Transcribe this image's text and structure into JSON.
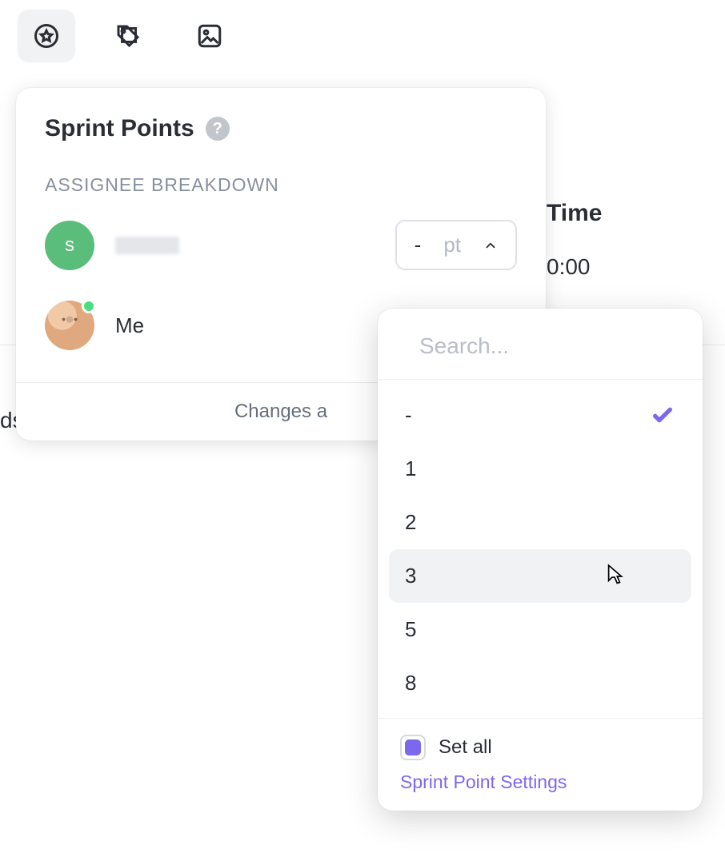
{
  "background": {
    "time_label": "Time",
    "time_value": "0:00",
    "left_fragment": "ds"
  },
  "card": {
    "title": "Sprint Points",
    "help_glyph": "?",
    "subheading": "ASSIGNEE BREAKDOWN",
    "assignees": [
      {
        "avatar_initial": "s",
        "name": "",
        "blurred": true
      },
      {
        "avatar_initial": "",
        "name": "Me",
        "blurred": false,
        "presence": true
      }
    ],
    "pt_select": {
      "value": "-",
      "unit": "pt"
    },
    "changes_text": "Changes a"
  },
  "dropdown": {
    "search_placeholder": "Search...",
    "options": [
      {
        "label": "-",
        "selected": true,
        "hovered": false
      },
      {
        "label": "1",
        "selected": false,
        "hovered": false
      },
      {
        "label": "2",
        "selected": false,
        "hovered": false
      },
      {
        "label": "3",
        "selected": false,
        "hovered": true
      },
      {
        "label": "5",
        "selected": false,
        "hovered": false
      },
      {
        "label": "8",
        "selected": false,
        "hovered": false
      }
    ],
    "set_all_label": "Set all",
    "settings_link": "Sprint Point Settings"
  }
}
